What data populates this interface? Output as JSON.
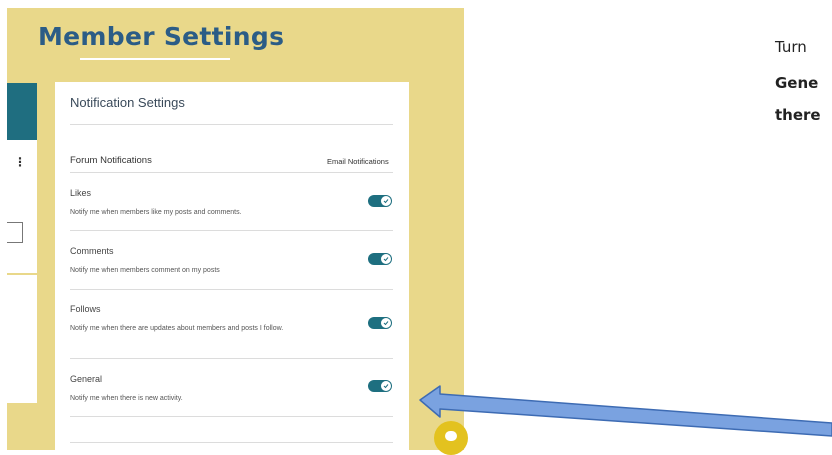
{
  "page_title": "Member Settings",
  "card": {
    "title": "Notification Settings",
    "forum_header": "Forum Notifications",
    "email_header": "Email Notifications",
    "items": [
      {
        "name": "Likes",
        "desc": "Notify me when members like my posts and comments.",
        "enabled": true
      },
      {
        "name": "Comments",
        "desc": "Notify me when members comment on my posts",
        "enabled": true
      },
      {
        "name": "Follows",
        "desc": "Notify me when there are updates about members and posts I follow.",
        "enabled": true
      },
      {
        "name": "General",
        "desc": "Notify me when there is new activity.",
        "enabled": true
      }
    ]
  },
  "instructions": {
    "line1": "Turn",
    "line2": "Gene",
    "line3": "there"
  },
  "icons": {
    "left_menu": "more-vertical-icon",
    "chat": "chat-icon",
    "toggle": "check-icon"
  },
  "colors": {
    "background_panel": "#e9d88a",
    "title": "#2b5c86",
    "toggle_on": "#1e6f80",
    "left_accent": "#1f6e80",
    "chat_button": "#e3c21f",
    "arrow": "#7aa2e0"
  }
}
